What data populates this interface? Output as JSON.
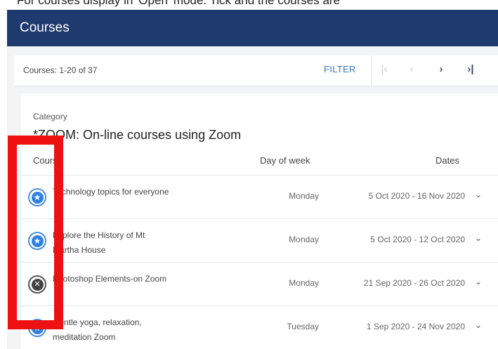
{
  "top_caption": "For courses display in 'Open' mode. Tick and the courses are",
  "header": {
    "title": "Courses"
  },
  "toolbar": {
    "count_text": "Courses: 1-20 of 37",
    "filter_label": "FILTER",
    "first_icon": "first-page-icon",
    "prev_icon": "previous-page-icon",
    "next_icon": "next-page-icon",
    "last_icon": "last-page-icon"
  },
  "category": {
    "label": "Category",
    "name": "*ZOOM: On-line courses using Zoom"
  },
  "columns": {
    "course": "Course",
    "day": "Day of week",
    "dates": "Dates"
  },
  "courses": [
    {
      "name": "Technology topics for everyone",
      "day": "Monday",
      "dates": "5 Oct 2020 - 16 Nov 2020",
      "status_icon": "star-icon"
    },
    {
      "name": "Explore the History of Mt Martha House",
      "day": "Monday",
      "dates": "5 Oct 2020 - 12 Oct 2020",
      "status_icon": "star-icon"
    },
    {
      "name": "Photoshop Elements-on Zoom",
      "day": "Monday",
      "dates": "21 Sep 2020 - 26 Oct 2020",
      "status_icon": "cancel-icon"
    },
    {
      "name": "Gentle yoga, relaxation, meditation Zoom",
      "day": "Tuesday",
      "dates": "1 Sep 2020 - 24 Nov 2020",
      "status_icon": "star-icon"
    }
  ],
  "colors": {
    "header_bg": "#1e3a6e",
    "accent": "#3a75c4",
    "highlight": "#ee1111"
  }
}
